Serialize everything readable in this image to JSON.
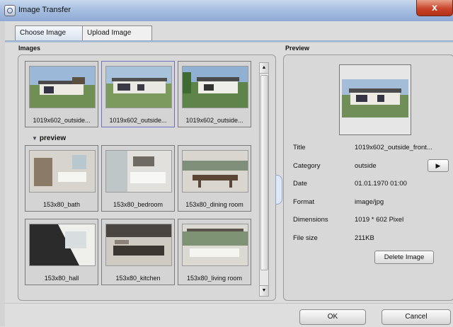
{
  "window": {
    "title": "Image Transfer",
    "close_glyph": "x"
  },
  "tabs": [
    {
      "label": "Choose Image",
      "active": true
    },
    {
      "label": "Upload Image",
      "active": false
    }
  ],
  "images_pane": {
    "title": "Images",
    "group_label": "preview",
    "group_arrow": "▼",
    "row1": [
      "1019x602_outside...",
      "1019x602_outside...",
      "1019x602_outside..."
    ],
    "row2": [
      "153x80_bath",
      "153x80_bedroom",
      "153x80_dining room"
    ],
    "row3": [
      "153x80_hall",
      "153x80_kitchen",
      "153x80_living room"
    ],
    "scroll_up": "▲",
    "scroll_down": "▼"
  },
  "preview_pane": {
    "title": "Preview",
    "properties": [
      {
        "label": "Title",
        "value": "1019x602_outside_front..."
      },
      {
        "label": "Category",
        "value": "outside"
      },
      {
        "label": "Date",
        "value": "01.01.1970 01:00"
      },
      {
        "label": "Format",
        "value": "image/jpg"
      },
      {
        "label": "Dimensions",
        "value": "1019 * 602 Pixel"
      },
      {
        "label": "File size",
        "value": "211KB"
      }
    ],
    "category_button_glyph": "▶",
    "delete_label": "Delete Image"
  },
  "footer": {
    "ok_label": "OK",
    "cancel_label": "Cancel"
  },
  "colors": {
    "title_bar": "#a7bfe1",
    "selection": "#6f6fc2",
    "close": "#c8452b"
  },
  "icons": [
    "window-icon",
    "close-icon",
    "collapse-arrow-icon",
    "scroll-up-icon",
    "scroll-down-icon",
    "play-icon"
  ]
}
